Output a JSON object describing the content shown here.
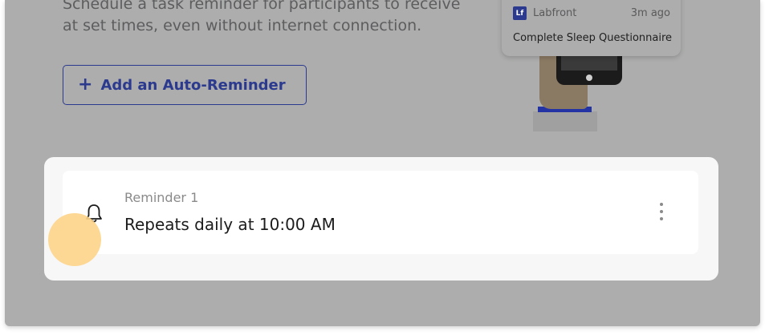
{
  "intro": {
    "description": "Schedule a task reminder for participants to receive at set times, even without internet connection."
  },
  "add_button": {
    "icon": "plus-icon",
    "label": "Add an Auto-Reminder"
  },
  "notification": {
    "logo_text": "Lf",
    "app_name": "Labfront",
    "time": "3m ago",
    "title": "Complete Sleep Questionnaire"
  },
  "reminder": {
    "icon": "bell-icon",
    "label": "Reminder 1",
    "schedule": "Repeats daily at 10:00 AM",
    "menu_icon": "more-vertical-icon"
  },
  "colors": {
    "overlay": "#acadac",
    "accent": "#2b3a8e",
    "tap_indicator": "#fdd48a"
  }
}
